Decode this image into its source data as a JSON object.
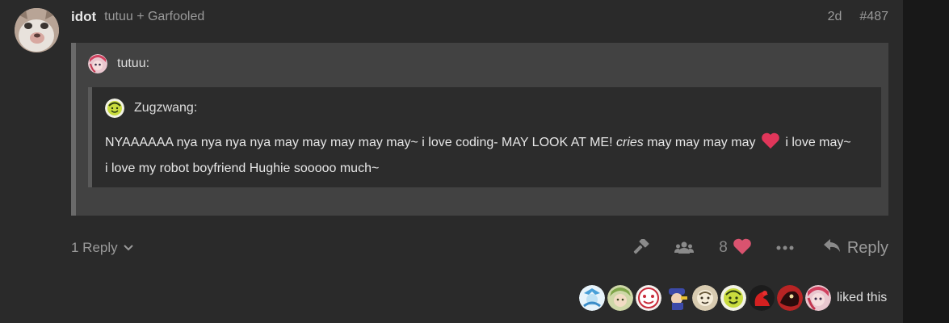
{
  "post": {
    "username": "idot",
    "reply_to": "tutuu + Garfooled",
    "age": "2d",
    "post_number": "#487",
    "avatar_icon": "cat-face-avatar"
  },
  "outer_quote": {
    "author": "tutuu:",
    "avatar_icon": "anime-girl-avatar"
  },
  "inner_quote": {
    "author": "Zugzwang:",
    "avatar_icon": "green-smiley-avatar",
    "text_part1": "NYAAAAAA nya nya nya nya may may may may may~ i love coding- MAY LOOK AT ME! ",
    "text_emphasis": "cries",
    "text_part2": " may may may may ",
    "text_part3": " i love may~ i love my robot boyfriend Hughie sooooo much~"
  },
  "actions": {
    "replies_label": "1 Reply",
    "like_count": "8",
    "reply_label": "Reply"
  },
  "likers": {
    "count_avatars": 10,
    "liked_text": "liked this"
  },
  "colors": {
    "heart": "#e0365a",
    "like_heart": "#d9536f",
    "background": "#2a2a2a"
  }
}
